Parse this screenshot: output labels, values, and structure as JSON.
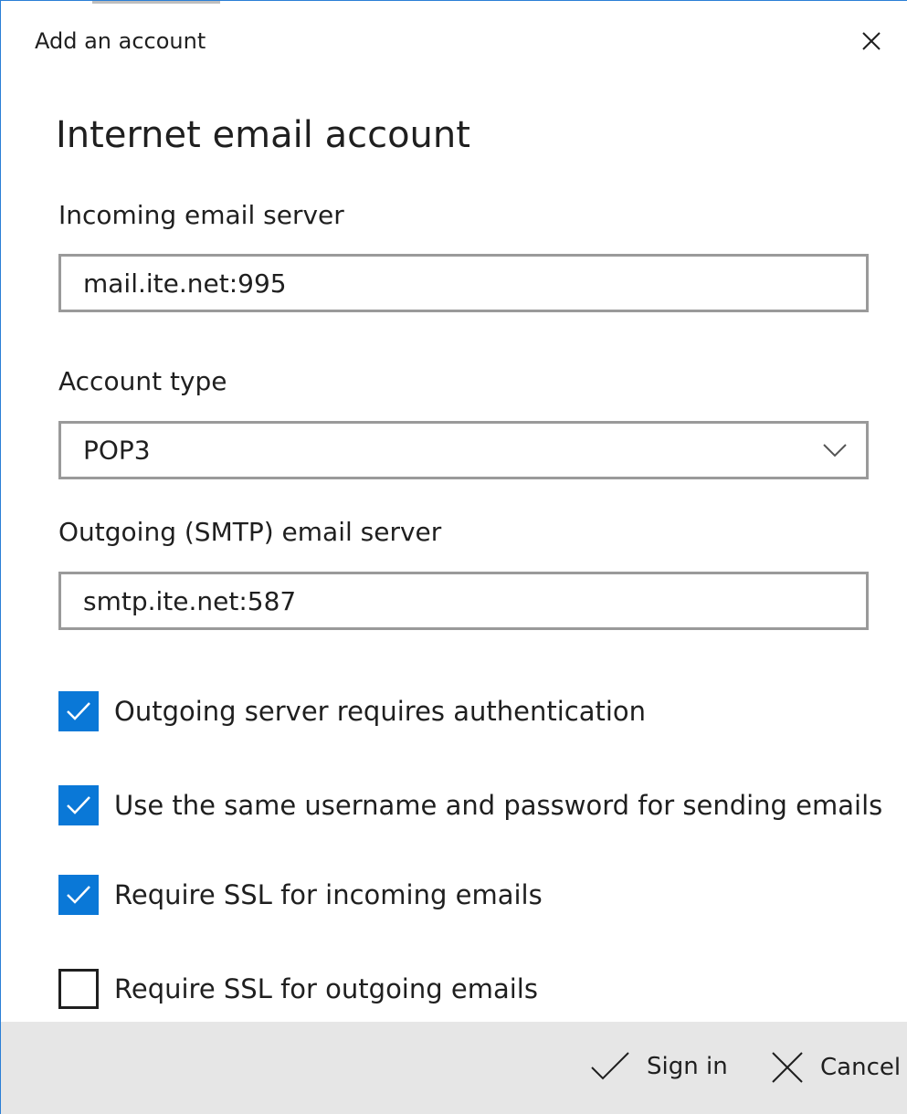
{
  "window": {
    "title": "Add an account",
    "close_icon": "close-icon"
  },
  "form": {
    "heading": "Internet email account",
    "incoming": {
      "label": "Incoming email server",
      "value": "mail.ite.net:995"
    },
    "account_type": {
      "label": "Account type",
      "selected": "POP3",
      "dropdown_icon": "chevron-down-icon"
    },
    "outgoing": {
      "label": "Outgoing (SMTP) email server",
      "value": "smtp.ite.net:587"
    },
    "options": [
      {
        "label": "Outgoing server requires authentication",
        "checked": true
      },
      {
        "label": "Use the same username and password for sending emails",
        "checked": true
      },
      {
        "label": "Require SSL for incoming emails",
        "checked": true
      },
      {
        "label": "Require SSL for outgoing emails",
        "checked": false
      }
    ]
  },
  "footer": {
    "sign_in_label": "Sign in",
    "sign_in_icon": "checkmark-icon",
    "cancel_label": "Cancel",
    "cancel_icon": "close-icon"
  },
  "colors": {
    "accent": "#0a78d7",
    "window_border": "#2b7fd6",
    "footer_bg": "#e6e6e6",
    "field_border": "#9a9a9a"
  }
}
